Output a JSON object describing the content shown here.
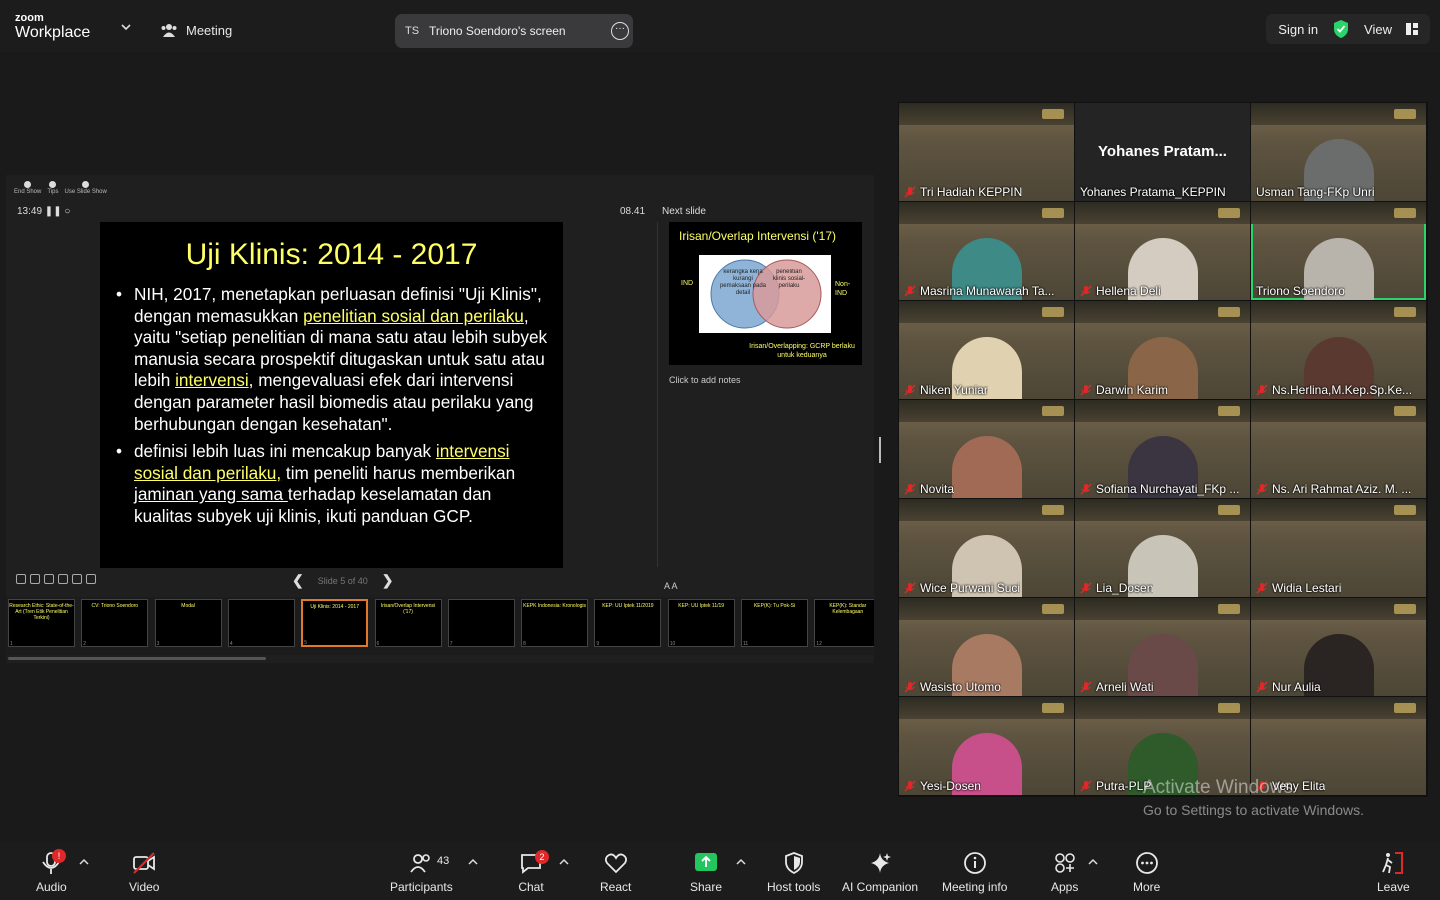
{
  "app": {
    "brand_small": "zoom",
    "brand_name": "Workplace",
    "meeting_label": "Meeting"
  },
  "share": {
    "initials": "TS",
    "title": "Triono Soendoro's screen"
  },
  "topright": {
    "sign_in": "Sign in",
    "view": "View"
  },
  "presenter": {
    "tools": [
      "End Show",
      "Tips",
      "Use Slide Show"
    ],
    "timer": "13:49",
    "elapsed": "08.41",
    "next_label": "Next slide",
    "notes_placeholder": "Click to add notes",
    "slide_counter": "Slide 5 of 40",
    "slide": {
      "title": "Uji Klinis: 2014 - 2017",
      "b1_t1": "NIH, 2017, menetapkan perluasan definisi \"Uji Klinis\", dengan memasukkan ",
      "b1_h1": "penelitian sosial dan perilaku",
      "b1_t2": ", yaitu \"setiap penelitian di mana satu atau lebih subyek manusia secara prospektif ditugaskan untuk satu atau lebih ",
      "b1_h2": "intervensi",
      "b1_t3": ", mengevaluasi efek dari intervensi dengan parameter hasil biomedis atau perilaku yang berhubungan dengan kesehatan\".",
      "b2_t1": "definisi lebih luas ini mencakup banyak ",
      "b2_h1": "intervensi sosial dan perilaku,",
      "b2_t2": " tim peneliti harus memberikan ",
      "b2_u1": "jaminan yang sama ",
      "b2_t3": "terhadap keselamatan dan kualitas subyek uji klinis, ikuti panduan GCP."
    },
    "next_slide": {
      "title": "Irisan/Overlap Intervensi ('17)",
      "left_label": "IND",
      "right_label": "Non-IND",
      "circle_left": "kerangka kerja kurangi pemaksaan pada detail",
      "circle_right": "penelitian klinis sosial-perilaku",
      "caption": "Irisan/Overlapping: GCRP berlaku untuk keduanya"
    },
    "thumbnails": [
      {
        "num": "1",
        "text": "Research Ethic: State-of-the-Art (Tren Etik Penelitian Terkini)"
      },
      {
        "num": "2",
        "text": "CV: Triono Soendoro"
      },
      {
        "num": "3",
        "text": "Modal"
      },
      {
        "num": "4",
        "text": ""
      },
      {
        "num": "5",
        "text": "Uji Klinis: 2014 - 2017"
      },
      {
        "num": "6",
        "text": "Irisan/Overlap Intervensi ('17)"
      },
      {
        "num": "7",
        "text": ""
      },
      {
        "num": "8",
        "text": "KEPK Indonesia: Kronologis"
      },
      {
        "num": "9",
        "text": "KEP: UU Iptek 11/2019"
      },
      {
        "num": "10",
        "text": "KEP: UU Iptek 11/19"
      },
      {
        "num": "11",
        "text": "KEP(K): Tu Pok-Si"
      },
      {
        "num": "12",
        "text": "KEP(K): Standar Kelembagaan"
      }
    ]
  },
  "participants": [
    {
      "name": "Tri Hadiah KEPPIN",
      "muted": true,
      "skin": "none"
    },
    {
      "name": "Yohanes Pratama_KEPPIN",
      "card": "Yohanes  Pratam...",
      "muted": false
    },
    {
      "name": "Usman Tang-FKp Unri",
      "muted": false,
      "skin": "#6b6d6c"
    },
    {
      "name": "Masrina Munawarah Ta...",
      "muted": true,
      "skin": "#3d8a86"
    },
    {
      "name": "Hellena Deli",
      "muted": true,
      "skin": "#d4ccc0"
    },
    {
      "name": "Triono Soendoro",
      "muted": false,
      "speaking": true,
      "skin": "#b8b4ac"
    },
    {
      "name": "Niken Yuniar",
      "muted": true,
      "skin": "#e0d2b0"
    },
    {
      "name": "Darwin Karim",
      "muted": true,
      "skin": "#8a6548"
    },
    {
      "name": "Ns.Herlina,M.Kep.Sp.Ke...",
      "muted": true,
      "skin": "#5a3a30"
    },
    {
      "name": "Novita",
      "muted": true,
      "skin": "#a06a55"
    },
    {
      "name": "Sofiana Nurchayati_FKp ...",
      "muted": true,
      "skin": "#3a3540"
    },
    {
      "name": "Ns. Ari Rahmat Aziz. M. ...",
      "muted": true,
      "skin": "none"
    },
    {
      "name": "Wice Purwani Suci",
      "muted": true,
      "skin": "#cfc3b2"
    },
    {
      "name": "Lia_Dosen",
      "muted": true,
      "skin": "#c8c4b8"
    },
    {
      "name": "Widia Lestari",
      "muted": true,
      "skin": "none"
    },
    {
      "name": "Wasisto Utomo",
      "muted": true,
      "skin": "#a87a62"
    },
    {
      "name": "Arneli Wati",
      "muted": true,
      "skin": "#6a4a48"
    },
    {
      "name": "Nur Aulia",
      "muted": true,
      "skin": "#2a2422"
    },
    {
      "name": "Yesi-Dosen",
      "muted": true,
      "skin": "#c8508a"
    },
    {
      "name": "Putra-PLP",
      "muted": true,
      "skin": "#2f5a2a"
    },
    {
      "name": "Veny Elita",
      "muted": true,
      "skin": "none"
    }
  ],
  "watermark": {
    "line1": "Activate Windows",
    "line2": "Go to Settings to activate Windows."
  },
  "toolbar": {
    "audio": "Audio",
    "audio_badge": "!",
    "video": "Video",
    "participants": "Participants",
    "participants_count": "43",
    "chat": "Chat",
    "chat_badge": "2",
    "react": "React",
    "share": "Share",
    "host_tools": "Host tools",
    "ai": "AI Companion",
    "info": "Meeting info",
    "apps": "Apps",
    "more": "More",
    "leave": "Leave"
  },
  "colors": {
    "accent_green": "#2bd36b",
    "leave_red": "#e02828",
    "slide_yellow": "#ffff66",
    "share_green": "#22c55e"
  }
}
